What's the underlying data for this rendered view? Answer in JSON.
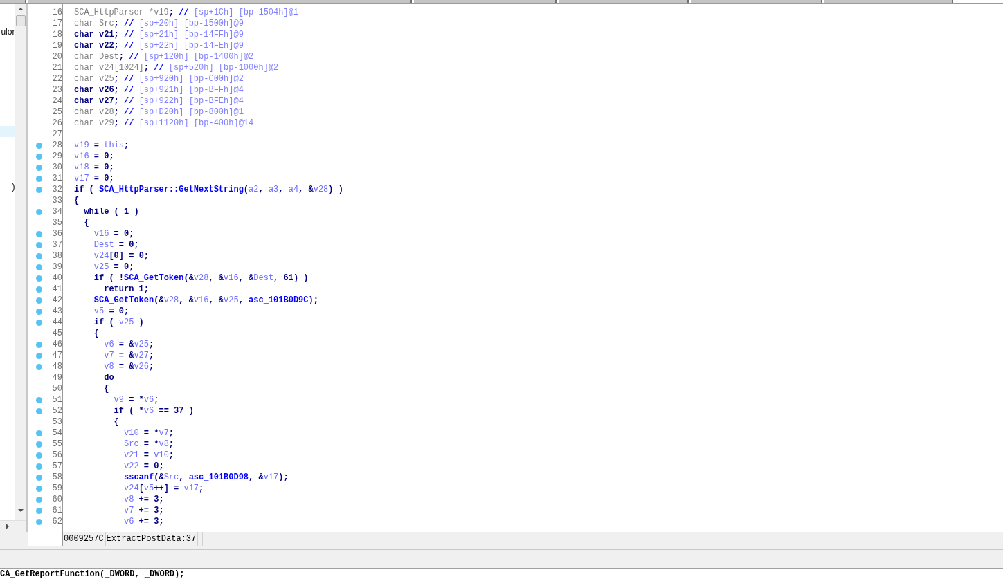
{
  "sidebar": {
    "items": [
      {
        "text": "ulor",
        "selected": false
      },
      {
        "selected": true
      },
      {
        "text": ")",
        "selected": false
      }
    ]
  },
  "code": {
    "lines": [
      {
        "number": "16",
        "breakpoint": false,
        "tokens": [
          {
            "kind": "dim",
            "text": "SCA_HttpParser *v19"
          },
          {
            "kind": "plain",
            "text": "; "
          },
          {
            "kind": "slashes",
            "text": "//"
          },
          {
            "kind": "comment",
            "text": " [sp+1Ch] [bp-1504h]@1"
          }
        ]
      },
      {
        "number": "17",
        "breakpoint": false,
        "tokens": [
          {
            "kind": "dim",
            "text": "char Src"
          },
          {
            "kind": "plain",
            "text": "; "
          },
          {
            "kind": "slashes",
            "text": "//"
          },
          {
            "kind": "comment",
            "text": " [sp+20h] [bp-1500h]@9"
          }
        ]
      },
      {
        "number": "18",
        "breakpoint": false,
        "tokens": [
          {
            "kind": "plain",
            "text": "char v21; "
          },
          {
            "kind": "slashes",
            "text": "//"
          },
          {
            "kind": "comment",
            "text": " [sp+21h] [bp-14FFh]@9"
          }
        ]
      },
      {
        "number": "19",
        "breakpoint": false,
        "tokens": [
          {
            "kind": "plain",
            "text": "char v22; "
          },
          {
            "kind": "slashes",
            "text": "//"
          },
          {
            "kind": "comment",
            "text": " [sp+22h] [bp-14FEh]@9"
          }
        ]
      },
      {
        "number": "20",
        "breakpoint": false,
        "tokens": [
          {
            "kind": "dim",
            "text": "char Dest"
          },
          {
            "kind": "plain",
            "text": "; "
          },
          {
            "kind": "slashes",
            "text": "//"
          },
          {
            "kind": "comment",
            "text": " [sp+120h] [bp-1400h]@2"
          }
        ]
      },
      {
        "number": "21",
        "breakpoint": false,
        "tokens": [
          {
            "kind": "dim",
            "text": "char v24[1024]"
          },
          {
            "kind": "plain",
            "text": "; "
          },
          {
            "kind": "slashes",
            "text": "//"
          },
          {
            "kind": "comment",
            "text": " [sp+520h] [bp-1000h]@2"
          }
        ]
      },
      {
        "number": "22",
        "breakpoint": false,
        "tokens": [
          {
            "kind": "dim",
            "text": "char v25"
          },
          {
            "kind": "plain",
            "text": "; "
          },
          {
            "kind": "slashes",
            "text": "//"
          },
          {
            "kind": "comment",
            "text": " [sp+920h] [bp-C00h]@2"
          }
        ]
      },
      {
        "number": "23",
        "breakpoint": false,
        "tokens": [
          {
            "kind": "plain",
            "text": "char v26; "
          },
          {
            "kind": "slashes",
            "text": "//"
          },
          {
            "kind": "comment",
            "text": " [sp+921h] [bp-BFFh]@4"
          }
        ]
      },
      {
        "number": "24",
        "breakpoint": false,
        "tokens": [
          {
            "kind": "plain",
            "text": "char v27; "
          },
          {
            "kind": "slashes",
            "text": "//"
          },
          {
            "kind": "comment",
            "text": " [sp+922h] [bp-BFEh]@4"
          }
        ]
      },
      {
        "number": "25",
        "breakpoint": false,
        "tokens": [
          {
            "kind": "dim",
            "text": "char v28"
          },
          {
            "kind": "plain",
            "text": "; "
          },
          {
            "kind": "slashes",
            "text": "//"
          },
          {
            "kind": "comment",
            "text": " [sp+D20h] [bp-800h]@1"
          }
        ]
      },
      {
        "number": "26",
        "breakpoint": false,
        "tokens": [
          {
            "kind": "dim",
            "text": "char v29"
          },
          {
            "kind": "plain",
            "text": "; "
          },
          {
            "kind": "slashes",
            "text": "//"
          },
          {
            "kind": "comment",
            "text": " [sp+1120h] [bp-400h]@14"
          }
        ]
      },
      {
        "number": "27",
        "breakpoint": false
      },
      {
        "number": "28",
        "breakpoint": true,
        "tokens": [
          {
            "kind": "var",
            "text": "v19"
          },
          {
            "kind": "plain",
            "text": " = "
          },
          {
            "kind": "var",
            "text": "this"
          },
          {
            "kind": "plain",
            "text": ";"
          }
        ]
      },
      {
        "number": "29",
        "breakpoint": true,
        "tokens": [
          {
            "kind": "var",
            "text": "v16"
          },
          {
            "kind": "plain",
            "text": " = 0;"
          }
        ]
      },
      {
        "number": "30",
        "breakpoint": true,
        "tokens": [
          {
            "kind": "var",
            "text": "v18"
          },
          {
            "kind": "plain",
            "text": " = 0;"
          }
        ]
      },
      {
        "number": "31",
        "breakpoint": true,
        "tokens": [
          {
            "kind": "var",
            "text": "v17"
          },
          {
            "kind": "plain",
            "text": " = 0;"
          }
        ]
      },
      {
        "number": "32",
        "breakpoint": true,
        "tokens": [
          {
            "kind": "plain",
            "text": "if ( "
          },
          {
            "kind": "name",
            "text": "SCA_HttpParser::GetNextString"
          },
          {
            "kind": "plain",
            "text": "("
          },
          {
            "kind": "var",
            "text": "a2"
          },
          {
            "kind": "plain",
            "text": ", "
          },
          {
            "kind": "var",
            "text": "a3"
          },
          {
            "kind": "plain",
            "text": ", "
          },
          {
            "kind": "var",
            "text": "a4"
          },
          {
            "kind": "plain",
            "text": ", &"
          },
          {
            "kind": "var",
            "text": "v28"
          },
          {
            "kind": "plain",
            "text": ") )"
          }
        ]
      },
      {
        "number": "33",
        "breakpoint": false,
        "tokens": [
          {
            "kind": "plain",
            "text": "{"
          }
        ]
      },
      {
        "number": "34",
        "breakpoint": true,
        "tokens": [
          {
            "kind": "plain",
            "text": "  while ( 1 )"
          }
        ]
      },
      {
        "number": "35",
        "breakpoint": false,
        "tokens": [
          {
            "kind": "plain",
            "text": "  {"
          }
        ]
      },
      {
        "number": "36",
        "breakpoint": true,
        "tokens": [
          {
            "kind": "var",
            "text": "    v16"
          },
          {
            "kind": "plain",
            "text": " = 0;"
          }
        ]
      },
      {
        "number": "37",
        "breakpoint": true,
        "tokens": [
          {
            "kind": "var",
            "text": "    Dest"
          },
          {
            "kind": "plain",
            "text": " = 0;"
          }
        ]
      },
      {
        "number": "38",
        "breakpoint": true,
        "tokens": [
          {
            "kind": "var",
            "text": "    v24"
          },
          {
            "kind": "plain",
            "text": "[0] = 0;"
          }
        ]
      },
      {
        "number": "39",
        "breakpoint": true,
        "tokens": [
          {
            "kind": "var",
            "text": "    v25"
          },
          {
            "kind": "plain",
            "text": " = 0;"
          }
        ]
      },
      {
        "number": "40",
        "breakpoint": true,
        "tokens": [
          {
            "kind": "plain",
            "text": "    if ( !"
          },
          {
            "kind": "name",
            "text": "SCA_GetToken"
          },
          {
            "kind": "plain",
            "text": "(&"
          },
          {
            "kind": "var",
            "text": "v28"
          },
          {
            "kind": "plain",
            "text": ", &"
          },
          {
            "kind": "var",
            "text": "v16"
          },
          {
            "kind": "plain",
            "text": ", &"
          },
          {
            "kind": "var",
            "text": "Dest"
          },
          {
            "kind": "plain",
            "text": ", 61) )"
          }
        ]
      },
      {
        "number": "41",
        "breakpoint": true,
        "tokens": [
          {
            "kind": "plain",
            "text": "      return 1;"
          }
        ]
      },
      {
        "number": "42",
        "breakpoint": true,
        "tokens": [
          {
            "kind": "name",
            "text": "    SCA_GetToken"
          },
          {
            "kind": "plain",
            "text": "(&"
          },
          {
            "kind": "var",
            "text": "v28"
          },
          {
            "kind": "plain",
            "text": ", &"
          },
          {
            "kind": "var",
            "text": "v16"
          },
          {
            "kind": "plain",
            "text": ", &"
          },
          {
            "kind": "var",
            "text": "v25"
          },
          {
            "kind": "plain",
            "text": ", "
          },
          {
            "kind": "name",
            "text": "asc_101B0D9C"
          },
          {
            "kind": "plain",
            "text": ");"
          }
        ]
      },
      {
        "number": "43",
        "breakpoint": true,
        "tokens": [
          {
            "kind": "var",
            "text": "    v5"
          },
          {
            "kind": "plain",
            "text": " = 0;"
          }
        ]
      },
      {
        "number": "44",
        "breakpoint": true,
        "tokens": [
          {
            "kind": "plain",
            "text": "    if ( "
          },
          {
            "kind": "var",
            "text": "v25"
          },
          {
            "kind": "plain",
            "text": " )"
          }
        ]
      },
      {
        "number": "45",
        "breakpoint": false,
        "tokens": [
          {
            "kind": "plain",
            "text": "    {"
          }
        ]
      },
      {
        "number": "46",
        "breakpoint": true,
        "tokens": [
          {
            "kind": "var",
            "text": "      v6"
          },
          {
            "kind": "plain",
            "text": " = &"
          },
          {
            "kind": "var",
            "text": "v25"
          },
          {
            "kind": "plain",
            "text": ";"
          }
        ]
      },
      {
        "number": "47",
        "breakpoint": true,
        "tokens": [
          {
            "kind": "var",
            "text": "      v7"
          },
          {
            "kind": "plain",
            "text": " = &"
          },
          {
            "kind": "var",
            "text": "v27"
          },
          {
            "kind": "plain",
            "text": ";"
          }
        ]
      },
      {
        "number": "48",
        "breakpoint": true,
        "tokens": [
          {
            "kind": "var",
            "text": "      v8"
          },
          {
            "kind": "plain",
            "text": " = &"
          },
          {
            "kind": "var",
            "text": "v26"
          },
          {
            "kind": "plain",
            "text": ";"
          }
        ]
      },
      {
        "number": "49",
        "breakpoint": false,
        "tokens": [
          {
            "kind": "plain",
            "text": "      do"
          }
        ]
      },
      {
        "number": "50",
        "breakpoint": false,
        "tokens": [
          {
            "kind": "plain",
            "text": "      {"
          }
        ]
      },
      {
        "number": "51",
        "breakpoint": true,
        "tokens": [
          {
            "kind": "var",
            "text": "        v9"
          },
          {
            "kind": "plain",
            "text": " = *"
          },
          {
            "kind": "var",
            "text": "v6"
          },
          {
            "kind": "plain",
            "text": ";"
          }
        ]
      },
      {
        "number": "52",
        "breakpoint": true,
        "tokens": [
          {
            "kind": "plain",
            "text": "        if ( *"
          },
          {
            "kind": "var",
            "text": "v6"
          },
          {
            "kind": "plain",
            "text": " == 37 )"
          }
        ]
      },
      {
        "number": "53",
        "breakpoint": false,
        "tokens": [
          {
            "kind": "plain",
            "text": "        {"
          }
        ]
      },
      {
        "number": "54",
        "breakpoint": true,
        "tokens": [
          {
            "kind": "var",
            "text": "          v10"
          },
          {
            "kind": "plain",
            "text": " = *"
          },
          {
            "kind": "var",
            "text": "v7"
          },
          {
            "kind": "plain",
            "text": ";"
          }
        ]
      },
      {
        "number": "55",
        "breakpoint": true,
        "tokens": [
          {
            "kind": "var",
            "text": "          Src"
          },
          {
            "kind": "plain",
            "text": " = *"
          },
          {
            "kind": "var",
            "text": "v8"
          },
          {
            "kind": "plain",
            "text": ";"
          }
        ]
      },
      {
        "number": "56",
        "breakpoint": true,
        "tokens": [
          {
            "kind": "var",
            "text": "          v21"
          },
          {
            "kind": "plain",
            "text": " = "
          },
          {
            "kind": "var",
            "text": "v10"
          },
          {
            "kind": "plain",
            "text": ";"
          }
        ]
      },
      {
        "number": "57",
        "breakpoint": true,
        "tokens": [
          {
            "kind": "var",
            "text": "          v22"
          },
          {
            "kind": "plain",
            "text": " = 0;"
          }
        ]
      },
      {
        "number": "58",
        "breakpoint": true,
        "tokens": [
          {
            "kind": "name",
            "text": "          sscanf"
          },
          {
            "kind": "plain",
            "text": "(&"
          },
          {
            "kind": "var",
            "text": "Src"
          },
          {
            "kind": "plain",
            "text": ", "
          },
          {
            "kind": "name",
            "text": "asc_101B0D98"
          },
          {
            "kind": "plain",
            "text": ", &"
          },
          {
            "kind": "var",
            "text": "v17"
          },
          {
            "kind": "plain",
            "text": ");"
          }
        ]
      },
      {
        "number": "59",
        "breakpoint": true,
        "tokens": [
          {
            "kind": "var",
            "text": "          v24"
          },
          {
            "kind": "plain",
            "text": "["
          },
          {
            "kind": "var",
            "text": "v5"
          },
          {
            "kind": "plain",
            "text": "++] = "
          },
          {
            "kind": "var",
            "text": "v17"
          },
          {
            "kind": "plain",
            "text": ";"
          }
        ]
      },
      {
        "number": "60",
        "breakpoint": true,
        "tokens": [
          {
            "kind": "var",
            "text": "          v8"
          },
          {
            "kind": "plain",
            "text": " += 3;"
          }
        ]
      },
      {
        "number": "61",
        "breakpoint": true,
        "tokens": [
          {
            "kind": "var",
            "text": "          v7"
          },
          {
            "kind": "plain",
            "text": " += 3;"
          }
        ]
      },
      {
        "number": "62",
        "breakpoint": true,
        "tokens": [
          {
            "kind": "var",
            "text": "          v6"
          },
          {
            "kind": "plain",
            "text": " += 3;"
          }
        ]
      }
    ]
  },
  "status_bar": {
    "address": "0009257C",
    "location": "ExtractPostData:37"
  },
  "output": {
    "lines": [
      "CA_GetReportFunction(_DWORD, _DWORD);"
    ]
  }
}
